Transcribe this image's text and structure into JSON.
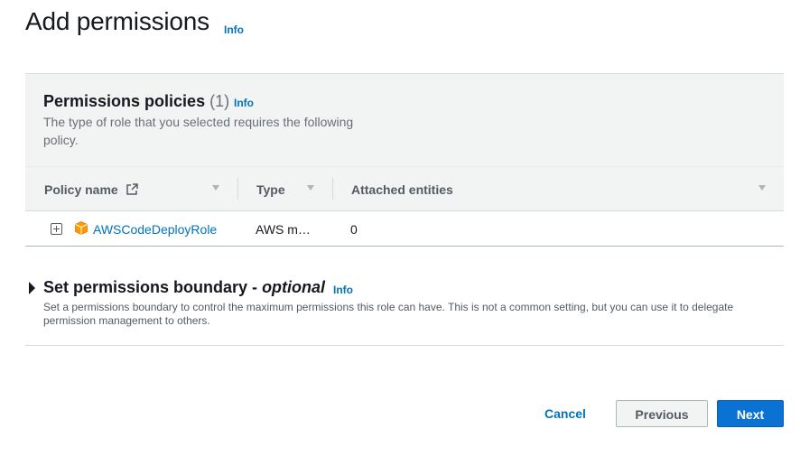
{
  "page": {
    "title": "Add permissions",
    "info": "Info"
  },
  "policies": {
    "title": "Permissions policies",
    "count": "(1)",
    "info": "Info",
    "description": "The type of role that you selected requires the following policy.",
    "columns": [
      "Policy name",
      "Type",
      "Attached entities"
    ],
    "rows": [
      {
        "name": "AWSCodeDeployRole",
        "type": "AWS m…",
        "attached": "0"
      }
    ],
    "icons": {
      "external": "external-link-icon",
      "policy": "cube-icon",
      "expand": "plus-square-icon"
    }
  },
  "boundary": {
    "title": "Set permissions boundary - ",
    "title_italic": "optional",
    "info": "Info",
    "description": "Set a permissions boundary to control the maximum permissions this role can have. This is not a common setting, but you can use it to delegate permission management to others."
  },
  "actions": {
    "cancel": "Cancel",
    "previous": "Previous",
    "next": "Next"
  },
  "colors": {
    "link": "#0073bb",
    "primary": "#0972d3",
    "icon_orange": "#ff9900"
  }
}
